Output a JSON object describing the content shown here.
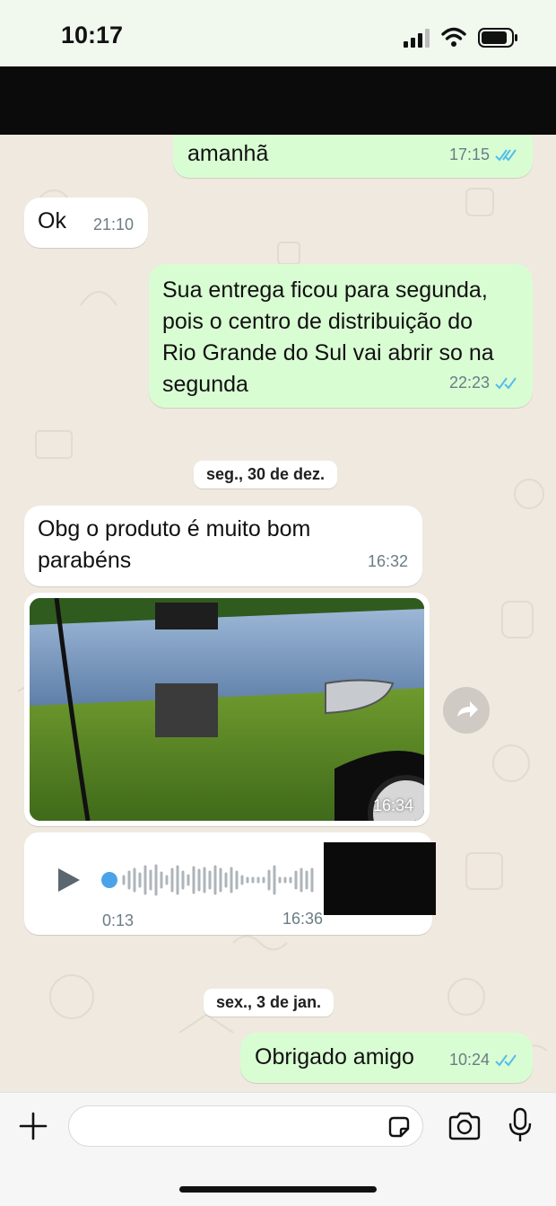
{
  "status_bar": {
    "time": "10:17"
  },
  "messages": [
    {
      "id": "m1",
      "direction": "out",
      "text": "amanhã",
      "time": "17:15",
      "status": "read"
    },
    {
      "id": "m2",
      "direction": "in",
      "text": "Ok",
      "time": "21:10"
    },
    {
      "id": "m3",
      "direction": "out",
      "text": "Sua entrega ficou para segunda,\npois o centro de distribuição do\nRio Grande do Sul vai abrir so na\nsegunda",
      "time": "22:23",
      "status": "read"
    },
    {
      "id": "m4",
      "direction": "in",
      "text": "Obg o produto é muito bom\nparabéns",
      "time": "16:32"
    },
    {
      "id": "m5",
      "direction": "in",
      "type": "image",
      "time": "16:34"
    },
    {
      "id": "m6",
      "direction": "in",
      "type": "audio",
      "duration": "0:13",
      "time": "16:36"
    },
    {
      "id": "m7",
      "direction": "out",
      "text": "Obrigado amigo",
      "time": "10:24",
      "status": "read"
    }
  ],
  "date_separators": [
    "seg., 30 de dez.",
    "sex., 3 de jan."
  ],
  "colors": {
    "outgoing_bubble": "#d9fdd3",
    "incoming_bubble": "#ffffff",
    "read_ticks": "#53bdeb",
    "audio_dot": "#4aa3e8"
  },
  "composer": {
    "icons": [
      "plus-icon",
      "sticker-icon",
      "camera-icon",
      "microphone-icon"
    ]
  }
}
